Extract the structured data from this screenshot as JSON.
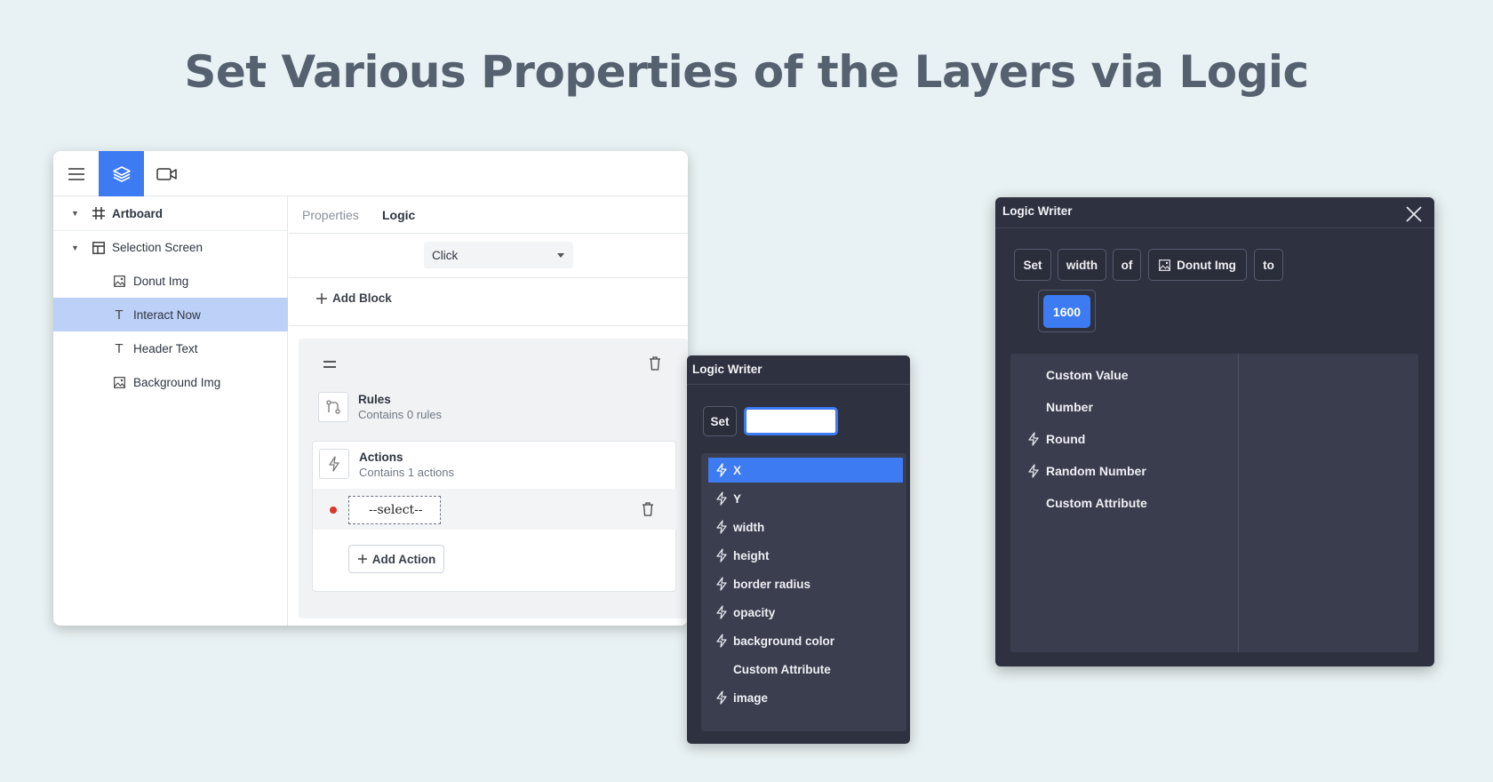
{
  "headline": "Set Various Properties of the Layers via Logic",
  "editor": {
    "tabs": {
      "properties": "Properties",
      "logic": "Logic"
    },
    "layers": [
      {
        "label": "Artboard",
        "icon": "artboard-icon"
      },
      {
        "label": "Selection Screen",
        "icon": "layout-icon"
      },
      {
        "label": "Donut Img",
        "icon": "image-icon"
      },
      {
        "label": "Interact Now",
        "icon": "text-icon",
        "selected": true
      },
      {
        "label": "Header Text",
        "icon": "text-icon"
      },
      {
        "label": "Background Img",
        "icon": "image-icon"
      }
    ],
    "trigger": "Click",
    "add_block": "Add Block",
    "rules": {
      "title": "Rules",
      "subtitle": "Contains 0 rules"
    },
    "actions": {
      "title": "Actions",
      "subtitle": "Contains 1 actions"
    },
    "select_value": "--select--",
    "add_action": "Add Action"
  },
  "logic_writer_mid": {
    "title": "Logic Writer",
    "set_label": "Set",
    "input_value": "",
    "options": [
      {
        "label": "X",
        "icon": "bolt-icon",
        "highlighted": true
      },
      {
        "label": "Y",
        "icon": "bolt-icon"
      },
      {
        "label": "width",
        "icon": "bolt-icon"
      },
      {
        "label": "height",
        "icon": "bolt-icon"
      },
      {
        "label": "border radius",
        "icon": "bolt-icon"
      },
      {
        "label": "opacity",
        "icon": "bolt-icon"
      },
      {
        "label": "background color",
        "icon": "bolt-icon"
      },
      {
        "label": "Custom Attribute",
        "icon": ""
      },
      {
        "label": "image",
        "icon": "bolt-icon"
      }
    ]
  },
  "logic_writer_right": {
    "title": "Logic Writer",
    "tokens": {
      "set": "Set",
      "property": "width",
      "of": "of",
      "layer": "Donut Img",
      "to": "to"
    },
    "value": "1600",
    "options": [
      {
        "label": "Custom Value",
        "icon": ""
      },
      {
        "label": "Number",
        "icon": ""
      },
      {
        "label": "Round",
        "icon": "bolt-icon"
      },
      {
        "label": "Random Number",
        "icon": "bolt-icon"
      },
      {
        "label": "Custom Attribute",
        "icon": ""
      }
    ]
  },
  "colors": {
    "accent": "#3d7bf2",
    "dark_panel": "#2e3140",
    "background": "#e8f1f3",
    "headline": "#566170"
  }
}
